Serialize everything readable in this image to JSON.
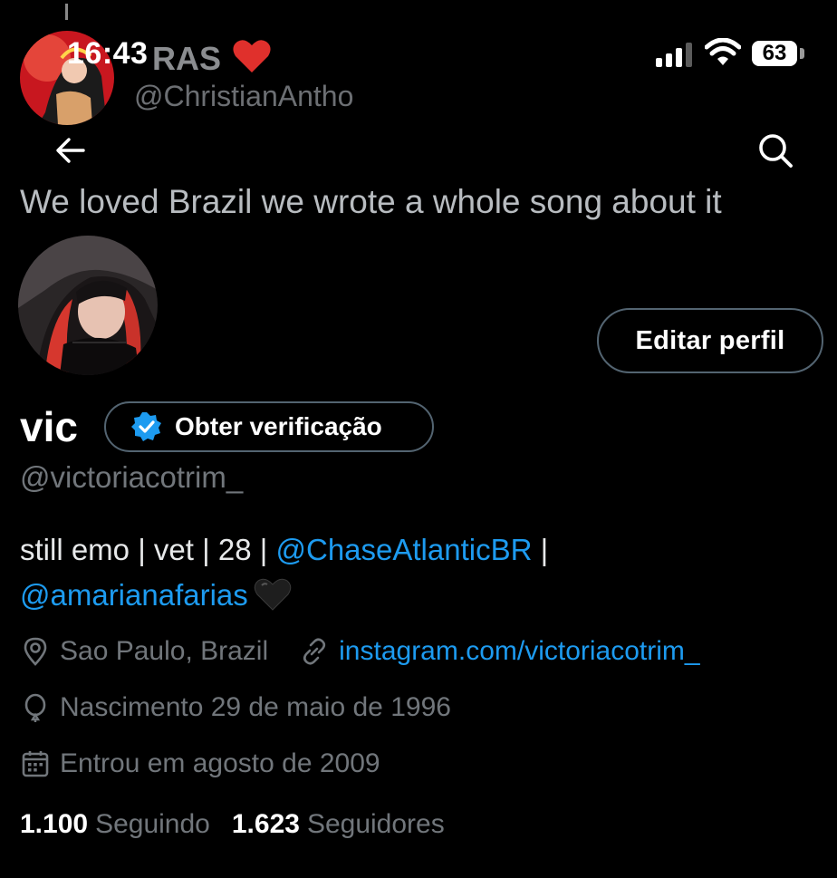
{
  "status_bar": {
    "time": "16:43",
    "battery": "63",
    "icons": [
      "signal-icon",
      "wifi-icon",
      "battery-icon"
    ]
  },
  "banner": {
    "name_fragment": "RAS",
    "handle": "@ChristianAntho",
    "tweet_text": "We loved Brazil we wrote a whole song about it",
    "heart_icon": "red-heart-icon"
  },
  "nav": {
    "back_icon": "back-arrow-icon",
    "search_icon": "search-icon"
  },
  "profile": {
    "display_name": "vic",
    "handle": "@victoriacotrim_",
    "edit_button": "Editar perfil",
    "verification_button": "Obter verificação",
    "bio": {
      "text": "still emo | vet | 28 | ",
      "mention1": "@ChaseAtlanticBR",
      "separator": " |",
      "mention2": "@amarianafarias",
      "emoji": "black-heart-icon"
    },
    "location": "Sao Paulo, Brazil",
    "website": "instagram.com/victoriacotrim_",
    "birth": "Nascimento 29 de maio de 1996",
    "joined": "Entrou em agosto de 2009",
    "following_count": "1.100",
    "following_label": "Seguindo",
    "followers_count": "1.623",
    "followers_label": "Seguidores"
  },
  "colors": {
    "background": "#000000",
    "link": "#1d9bf0",
    "muted": "#71767b",
    "verified": "#1d9bf0"
  }
}
